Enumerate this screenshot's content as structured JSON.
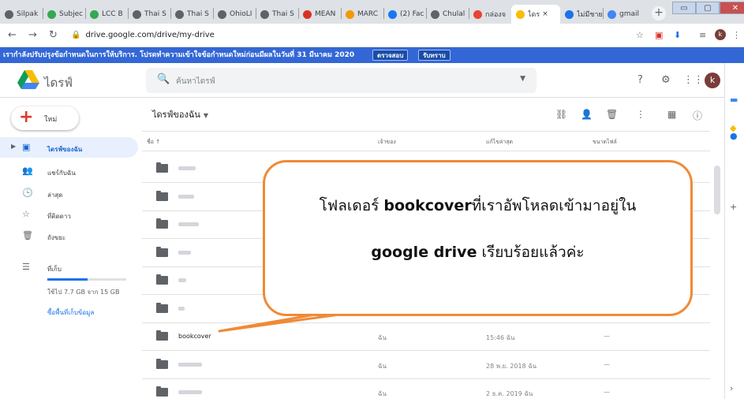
{
  "browser": {
    "tabs": [
      {
        "title": "Silpak",
        "icon_color": "#5f6368"
      },
      {
        "title": "Subjec",
        "icon_color": "#34a853"
      },
      {
        "title": "LCC B",
        "icon_color": "#34a853"
      },
      {
        "title": "Thai S",
        "icon_color": "#5f6368"
      },
      {
        "title": "Thai S",
        "icon_color": "#5f6368"
      },
      {
        "title": "OhioLI",
        "icon_color": "#5f6368"
      },
      {
        "title": "Thai S",
        "icon_color": "#5f6368"
      },
      {
        "title": "MEAN",
        "icon_color": "#d93025"
      },
      {
        "title": "MARC",
        "icon_color": "#f29900"
      },
      {
        "title": "(2) Fac",
        "icon_color": "#1877f2"
      },
      {
        "title": "Chulal",
        "icon_color": "#5f6368"
      },
      {
        "title": "กล่องจ",
        "icon_color": "#ea4335"
      },
      {
        "title": "ไดร",
        "icon_color": "#fbbc04"
      },
      {
        "title": "ไม่มีชาย",
        "icon_color": "#1a73e8"
      },
      {
        "title": "gmail",
        "icon_color": "#4285f4"
      }
    ],
    "active_tab_index": 12,
    "active_tab_close": "×",
    "new_tab": "+",
    "window_min": "▭",
    "window_max": "▢",
    "window_close": "✕",
    "url": "drive.google.com/drive/my-drive",
    "profile_initial": "k"
  },
  "banner": {
    "text": "เรากำลังปรับปรุงข้อกำหนดในการให้บริการ. โปรดทำความเข้าใจข้อกำหนดใหม่ก่อนมีผลในวันที่ 31 มีนาคม 2020",
    "review_label": "ตรวจสอบ",
    "dismiss_label": "รับทราบ"
  },
  "drive": {
    "brand": "ไดรฟ์",
    "search_placeholder": "ค้นหาไดรฟ์",
    "avatar_initial": "k",
    "new_label": "ใหม่",
    "sidebar": [
      {
        "label": "ไดรฟ์ของฉัน",
        "icon": "my-drive-icon",
        "glyph": "▣",
        "active": true
      },
      {
        "label": "แชร์กับฉัน",
        "icon": "shared-icon",
        "glyph": "👥",
        "active": false
      },
      {
        "label": "ล่าสุด",
        "icon": "clock-icon",
        "glyph": "🕒",
        "active": false
      },
      {
        "label": "ที่ติดดาว",
        "icon": "star-icon",
        "glyph": "☆",
        "active": false
      },
      {
        "label": "ถังขยะ",
        "icon": "trash-icon",
        "glyph": "🗑",
        "active": false
      }
    ],
    "storage": {
      "label": "ที่เก็บ",
      "used_text": "ใช้ไป 7.7 GB จาก 15 GB",
      "used_fraction": 0.51,
      "buy_label": "ซื้อพื้นที่เก็บข้อมูล"
    },
    "page_title": "ไดรฟ์ของฉัน",
    "columns": {
      "name": "ชื่อ",
      "owner": "เจ้าของ",
      "modified": "แก้ไขล่าสุด",
      "size": "ขนาดไฟล์"
    },
    "files": [
      {
        "name": "",
        "owner": "",
        "modified": "",
        "size": ""
      },
      {
        "name": "",
        "owner": "",
        "modified": "",
        "size": ""
      },
      {
        "name": "",
        "owner": "",
        "modified": "",
        "size": ""
      },
      {
        "name": "",
        "owner": "",
        "modified": "",
        "size": ""
      },
      {
        "name": "",
        "owner": "",
        "modified": "",
        "size": ""
      },
      {
        "name": "",
        "owner": "",
        "modified": "",
        "size": ""
      },
      {
        "name": "bookcover",
        "owner": "ฉัน",
        "modified": "15:46 ฉัน",
        "size": "—"
      },
      {
        "name": "",
        "owner": "ฉัน",
        "modified": "28 พ.ย. 2018 ฉัน",
        "size": "—"
      },
      {
        "name": "",
        "owner": "ฉัน",
        "modified": "2 ธ.ค. 2019 ฉัน",
        "size": "—"
      }
    ]
  },
  "callout": {
    "line1_pre": "โฟลเดอร์ ",
    "line1_bold": "bookcover",
    "line1_post": "ที่เราอัพโหลดเข้ามาอยู่ใน",
    "line2_bold": "google drive",
    "line2_post": " เรียบร้อยแล้วค่ะ",
    "color": "#f08a35"
  }
}
